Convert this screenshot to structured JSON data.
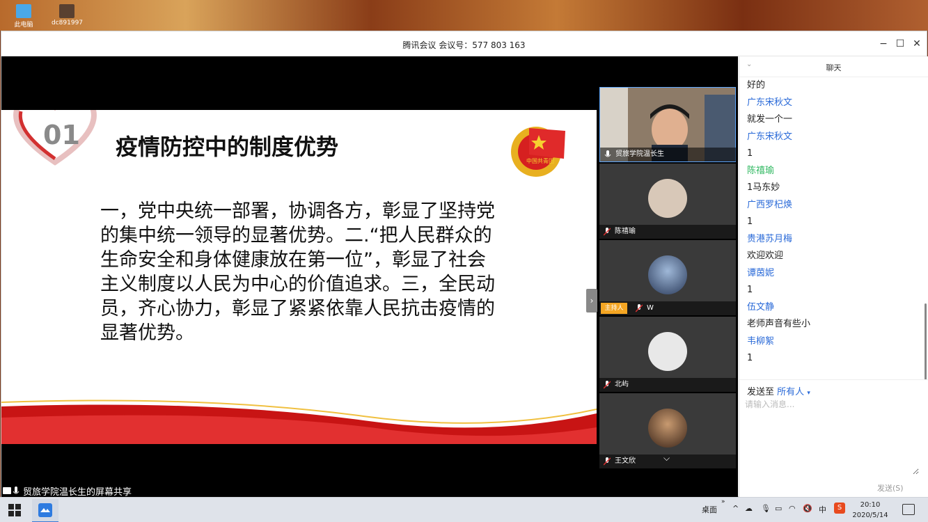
{
  "desktop": {
    "icons": [
      {
        "label": "此电脑",
        "icon": "computer-icon"
      },
      {
        "label": "dc891997",
        "icon": "image-file-icon"
      }
    ]
  },
  "window": {
    "title": "腾讯会议  会议号：577 803 163",
    "minimize": "−",
    "maximize": "☐",
    "close": "✕"
  },
  "slide": {
    "number": "01",
    "title": "疫情防控中的制度优势",
    "body": "一，党中央统一部署，协调各方，彰显了坚持党的集中统一领导的显著优势。二.“把人民群众的生命安全和身体健康放在第一位”，彰显了社会主义制度以人民为中心的价值追求。三，全民动员，齐心协力，彰显了紧紧依靠人民抗击疫情的显著优势。",
    "emblem_text": "中国共青团"
  },
  "share_label": "贸旅学院温长生的屏幕共享",
  "participants": [
    {
      "name": "贸旅学院温长生",
      "camera": true
    },
    {
      "name": "陈禧瑜"
    },
    {
      "name": "W",
      "badge": "主持人"
    },
    {
      "name": "北屿"
    },
    {
      "name": "王文欣"
    }
  ],
  "panel_toggle": "›",
  "tile_chevron": "⌵",
  "chat": {
    "title": "聊天",
    "collapse": "⌄",
    "messages": [
      {
        "sender": "",
        "text": "好的"
      },
      {
        "sender": "广东宋秋文",
        "text": "就发一个一",
        "color": "#2a6ad8"
      },
      {
        "sender": "广东宋秋文",
        "text": "1",
        "color": "#2a6ad8"
      },
      {
        "sender": "陈禧瑜",
        "text": "1马东妙",
        "color": "#2fb860"
      },
      {
        "sender": "广西罗杞焕",
        "text": "1",
        "color": "#2a6ad8"
      },
      {
        "sender": "贵港苏月梅",
        "text": "欢迎欢迎",
        "color": "#2a6ad8"
      },
      {
        "sender": "谭茵妮",
        "text": "1",
        "color": "#2a6ad8"
      },
      {
        "sender": "伍文静",
        "text": "老师声音有些小",
        "color": "#2a6ad8"
      },
      {
        "sender": "韦柳絮",
        "text": "1",
        "color": "#2a6ad8"
      }
    ],
    "send_to_label": "发送至",
    "send_to_target": "所有人",
    "input_placeholder": "请输入消息...",
    "send_button": "发送(S)"
  },
  "taskbar": {
    "desktop_label": "桌面",
    "ime": "中",
    "time": "20:10",
    "date": "2020/5/14"
  }
}
